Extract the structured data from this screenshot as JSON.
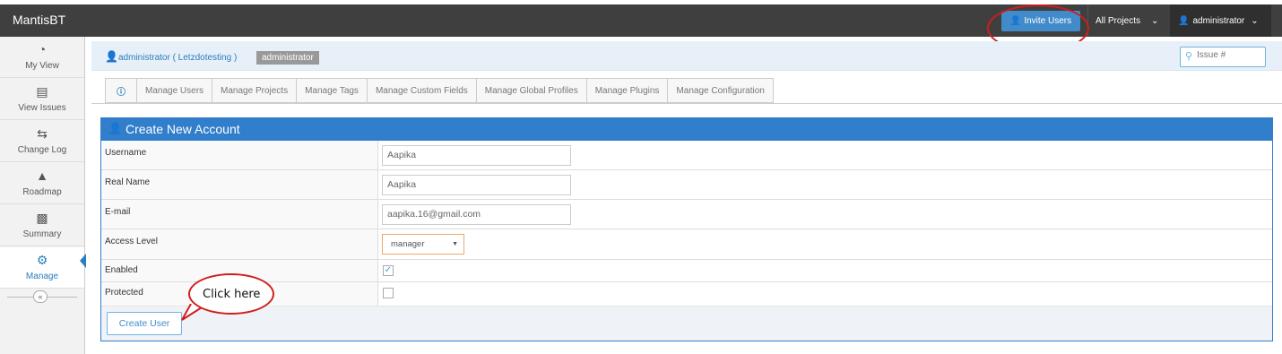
{
  "app": {
    "brand": "MantisBT"
  },
  "navbar": {
    "invite_label": "Invite Users",
    "projects_label": "All Projects",
    "user_label": "administrator"
  },
  "sidebar": {
    "items": [
      {
        "label": "My View",
        "icon": "dashboard-icon"
      },
      {
        "label": "View Issues",
        "icon": "list-icon"
      },
      {
        "label": "Change Log",
        "icon": "retweet-icon"
      },
      {
        "label": "Roadmap",
        "icon": "road-icon"
      },
      {
        "label": "Summary",
        "icon": "bar-chart-icon"
      },
      {
        "label": "Manage",
        "icon": "gears-icon",
        "active": true
      }
    ],
    "collapse_symbol": "«"
  },
  "breadcrumb": {
    "user_link": "administrator ( Letzdotesting )",
    "role_badge": "administrator"
  },
  "search": {
    "placeholder": "Issue #"
  },
  "tabs": [
    "Manage Users",
    "Manage Projects",
    "Manage Tags",
    "Manage Custom Fields",
    "Manage Global Profiles",
    "Manage Plugins",
    "Manage Configuration"
  ],
  "form": {
    "title": "Create New Account",
    "username_label": "Username",
    "username_value": "Aapika",
    "realname_label": "Real Name",
    "realname_value": "Aapika",
    "email_label": "E-mail",
    "email_value": "aapika.16@gmail.com",
    "access_label": "Access Level",
    "access_value": "manager",
    "enabled_label": "Enabled",
    "enabled_checked": true,
    "protected_label": "Protected",
    "protected_checked": false,
    "submit_label": "Create User"
  },
  "annotation": {
    "callout_text": "Click here"
  },
  "colors": {
    "navbar": "#3f3f3f",
    "primary": "#307ecc",
    "annotation": "#d21c1c"
  }
}
